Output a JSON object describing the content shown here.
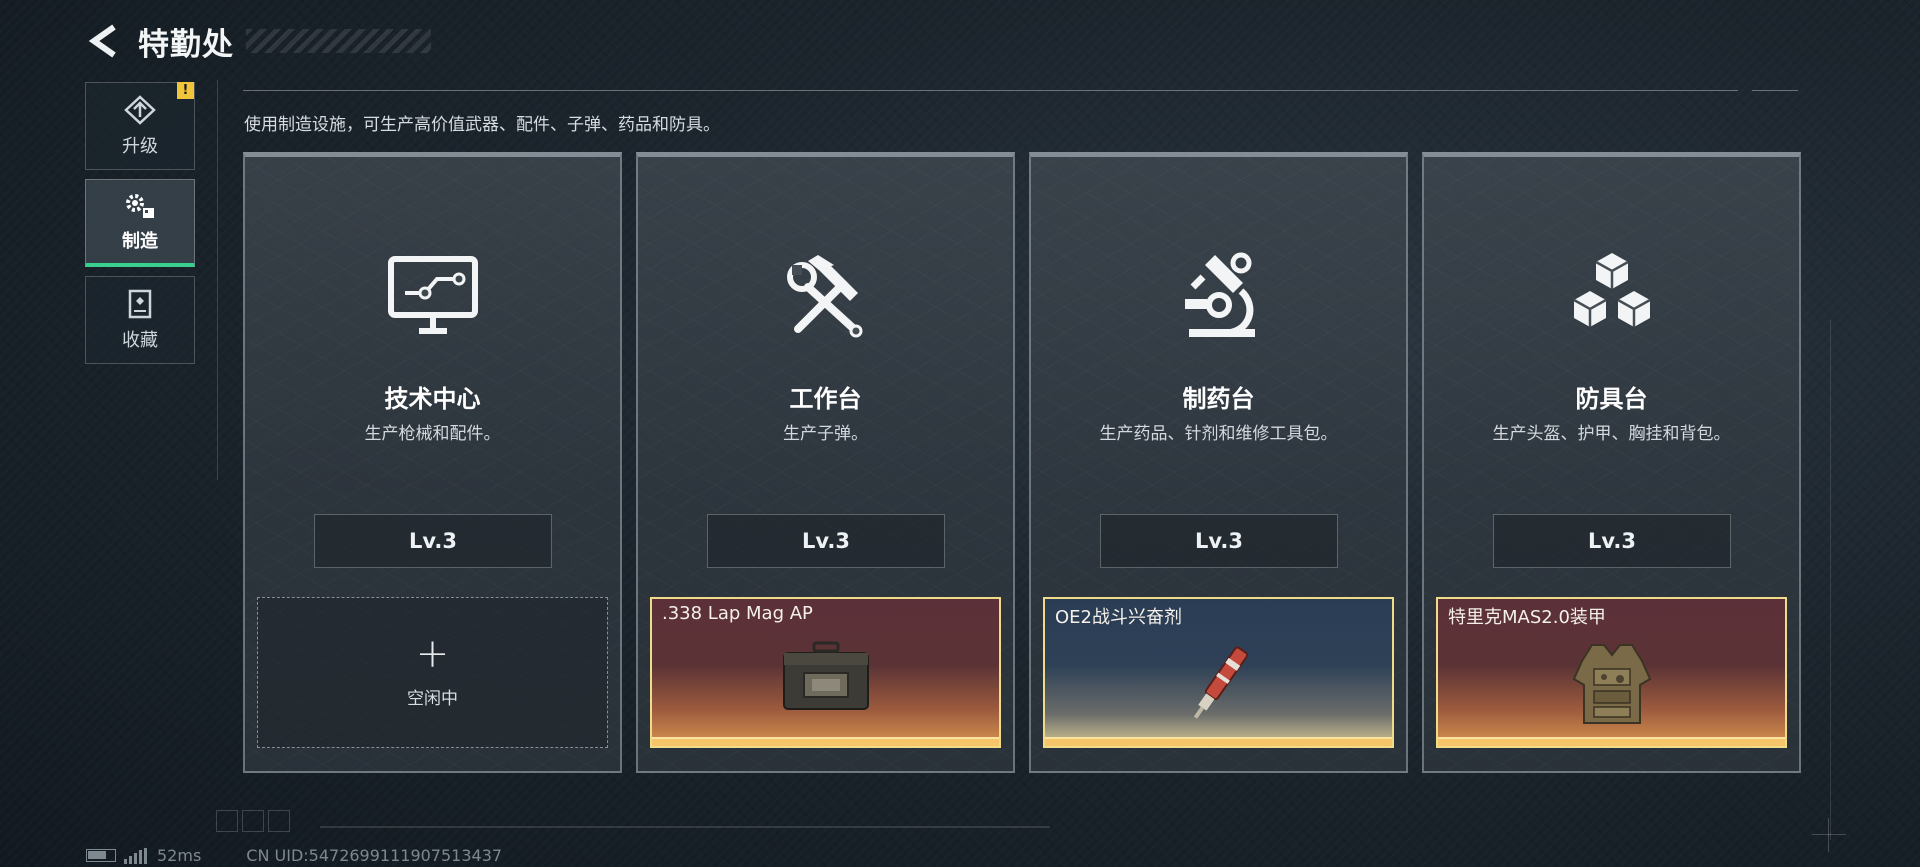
{
  "header": {
    "title": "特勤处"
  },
  "sidebar": {
    "items": [
      {
        "label": "升级",
        "icon": "upgrade-icon",
        "badge": "!"
      },
      {
        "label": "制造",
        "icon": "gears-icon",
        "active": true
      },
      {
        "label": "收藏",
        "icon": "collection-icon"
      }
    ]
  },
  "main": {
    "description": "使用制造设施，可生产高价值武器、配件、子弹、药品和防具。",
    "cards": [
      {
        "title": "技术中心",
        "desc": "生产枪械和配件。",
        "level": "Lv.3",
        "icon": "monitor-icon",
        "slot": {
          "state": "empty",
          "plus": "+",
          "text": "空闲中"
        }
      },
      {
        "title": "工作台",
        "desc": "生产子弹。",
        "level": "Lv.3",
        "icon": "hammer-wrench-icon",
        "slot": {
          "state": "item",
          "name": ".338 Lap Mag AP",
          "color": "#5c3038",
          "icon": "ammo-box-icon"
        }
      },
      {
        "title": "制药台",
        "desc": "生产药品、针剂和维修工具包。",
        "level": "Lv.3",
        "icon": "microscope-icon",
        "slot": {
          "state": "item",
          "name": "OE2战斗兴奋剂",
          "color": "#2b3d55",
          "icon": "injector-icon"
        }
      },
      {
        "title": "防具台",
        "desc": "生产头盔、护甲、胸挂和背包。",
        "level": "Lv.3",
        "icon": "cubes-icon",
        "slot": {
          "state": "item",
          "name": "特里克MAS2.0装甲",
          "color": "#5c3038",
          "icon": "armor-vest-icon"
        }
      }
    ]
  },
  "status": {
    "ping": "52ms",
    "uid": "CN UID:5472699111907513437"
  },
  "colors": {
    "active_tab": "#39d08f",
    "badge": "#f1c53b",
    "item_border": "#f0dc88",
    "progress": "#f6c56a"
  }
}
